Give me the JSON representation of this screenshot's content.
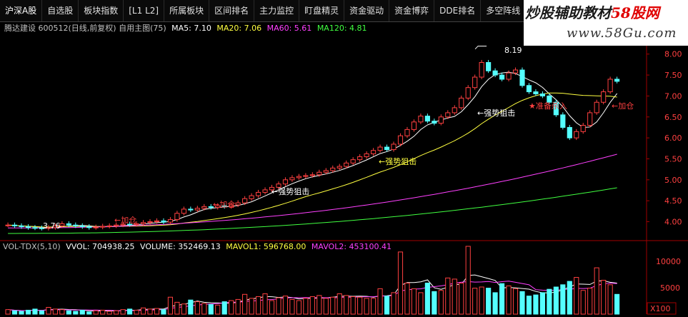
{
  "tabs": [
    "沪深A股",
    "自选股",
    "板块指数",
    "[L1 L2]",
    "所属板块",
    "区间排名",
    "主力监控",
    "盯盘精灵",
    "资金驱动",
    "资金博弈",
    "DDE排名",
    "多空阵线"
  ],
  "watermark": {
    "title_a": "炒股辅助教材",
    "title_b": "58股网",
    "url": "www.58Gu.com"
  },
  "info": {
    "stock": "腾达建设 600512(日线,前复权) 自用主图(75)",
    "ma5": "MA5: 7.10",
    "ma20": "MA20: 7.06",
    "ma60": "MA60: 5.61",
    "ma120": "MA120: 4.81"
  },
  "price_axis": [
    "8.00",
    "7.50",
    "7.00",
    "6.50",
    "6.00",
    "5.50",
    "5.00",
    "4.50",
    "4.00"
  ],
  "annotations": {
    "high": "8.19",
    "low": "3.76",
    "a1": "←强势狙击",
    "a2": "←强势狙击",
    "a3": "←强势狙击",
    "add1": "←加仓",
    "add2": "←加仓",
    "add3": "←加仓",
    "star": "★准备杀入",
    "gap": "×"
  },
  "volume": {
    "title": "VOL-TDX(5,10)",
    "vvol": "VVOL: 704938.25",
    "vol": "VOLUME: 352469.13",
    "mavol1": "MAVOL1: 596768.00",
    "mavol2": "MAVOL2: 453100.41",
    "axis": [
      "10000",
      "5000"
    ],
    "unit": "X100"
  },
  "colors": {
    "up": "#ff4040",
    "down": "#54ffff",
    "ma5": "#ffffff",
    "ma20": "#ffff40",
    "ma60": "#ff40ff",
    "ma120": "#40ff40"
  },
  "chart_data": {
    "type": "candlestick",
    "closes": [
      3.92,
      3.9,
      3.88,
      3.86,
      3.85,
      3.84,
      3.86,
      3.9,
      3.95,
      3.92,
      3.9,
      3.88,
      3.86,
      3.87,
      3.89,
      3.9,
      3.92,
      3.94,
      3.93,
      3.95,
      3.98,
      4.0,
      4.02,
      3.99,
      4.05,
      4.2,
      4.3,
      4.28,
      4.32,
      4.36,
      4.34,
      4.38,
      4.36,
      4.4,
      4.45,
      4.55,
      4.62,
      4.7,
      4.76,
      4.82,
      4.9,
      5.0,
      5.05,
      5.08,
      5.1,
      5.12,
      5.18,
      5.22,
      5.28,
      5.32,
      5.4,
      5.48,
      5.55,
      5.62,
      5.7,
      5.78,
      5.72,
      5.85,
      6.05,
      6.2,
      6.38,
      6.52,
      6.4,
      6.35,
      6.5,
      6.6,
      6.72,
      6.95,
      7.2,
      7.45,
      7.8,
      7.6,
      7.5,
      7.4,
      7.55,
      7.62,
      7.25,
      7.1,
      7.05,
      7.0,
      6.85,
      6.55,
      6.25,
      6.0,
      6.15,
      6.3,
      6.6,
      6.85,
      7.1,
      7.4,
      7.35
    ],
    "volumes": [
      800,
      600,
      500,
      700,
      900,
      600,
      1200,
      900,
      800,
      600,
      500,
      700,
      400,
      600,
      700,
      500,
      600,
      800,
      900,
      700,
      1100,
      900,
      1000,
      800,
      3000,
      2100,
      1800,
      2500,
      2200,
      1900,
      1700,
      1600,
      2200,
      2400,
      2600,
      3500,
      2800,
      3100,
      3600,
      2400,
      2900,
      3200,
      2600,
      2400,
      2800,
      3100,
      3300,
      2800,
      3000,
      3600,
      3300,
      3100,
      3000,
      2800,
      2800,
      4500,
      3200,
      3800,
      11000,
      5500,
      4500,
      3800,
      5500,
      4000,
      4200,
      6400,
      6200,
      5500,
      12000,
      4600,
      4800,
      4600,
      3800,
      5400,
      5000,
      4500,
      4000,
      3200,
      3400,
      3800,
      4400,
      4800,
      5200,
      5800,
      6500,
      4200,
      4600,
      8200,
      6000,
      5200,
      3500
    ],
    "ylim": [
      3.6,
      8.2
    ],
    "vol_ylim": [
      0,
      12000
    ],
    "ma60_end": 5.61,
    "ma120_end": 4.81,
    "ma5_end": 7.1,
    "ma20_end": 7.06,
    "high": 8.19,
    "low": 3.76
  }
}
